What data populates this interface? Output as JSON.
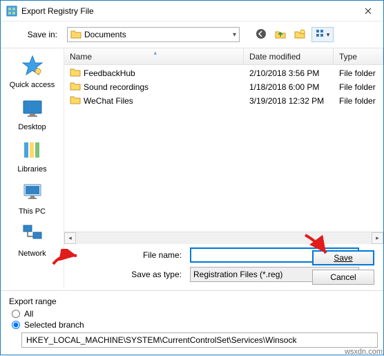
{
  "window": {
    "title": "Export Registry File"
  },
  "toolbar": {
    "save_in_label": "Save in:",
    "current_folder": "Documents",
    "icons": {
      "back": "back-icon",
      "up": "up-icon",
      "newfolder": "new-folder-icon",
      "views": "views-icon"
    }
  },
  "places": [
    {
      "key": "quick",
      "label": "Quick access"
    },
    {
      "key": "desktop",
      "label": "Desktop"
    },
    {
      "key": "libraries",
      "label": "Libraries"
    },
    {
      "key": "thispc",
      "label": "This PC"
    },
    {
      "key": "network",
      "label": "Network"
    }
  ],
  "file_list": {
    "headers": {
      "name": "Name",
      "date": "Date modified",
      "type": "Type"
    },
    "rows": [
      {
        "name": "FeedbackHub",
        "date": "2/10/2018 3:56 PM",
        "type": "File folder"
      },
      {
        "name": "Sound recordings",
        "date": "1/18/2018 6:00 PM",
        "type": "File folder"
      },
      {
        "name": "WeChat Files",
        "date": "3/19/2018 12:32 PM",
        "type": "File folder"
      }
    ]
  },
  "form": {
    "filename_label": "File name:",
    "filename_value": "",
    "saveastype_label": "Save as type:",
    "saveastype_value": "Registration Files (*.reg)",
    "save_button": "Save",
    "cancel_button": "Cancel"
  },
  "export_range": {
    "group_label": "Export range",
    "all_label": "All",
    "selected_label": "Selected branch",
    "branch_value": "HKEY_LOCAL_MACHINE\\SYSTEM\\CurrentControlSet\\Services\\Winsock"
  },
  "watermark": "wsxdn.com"
}
